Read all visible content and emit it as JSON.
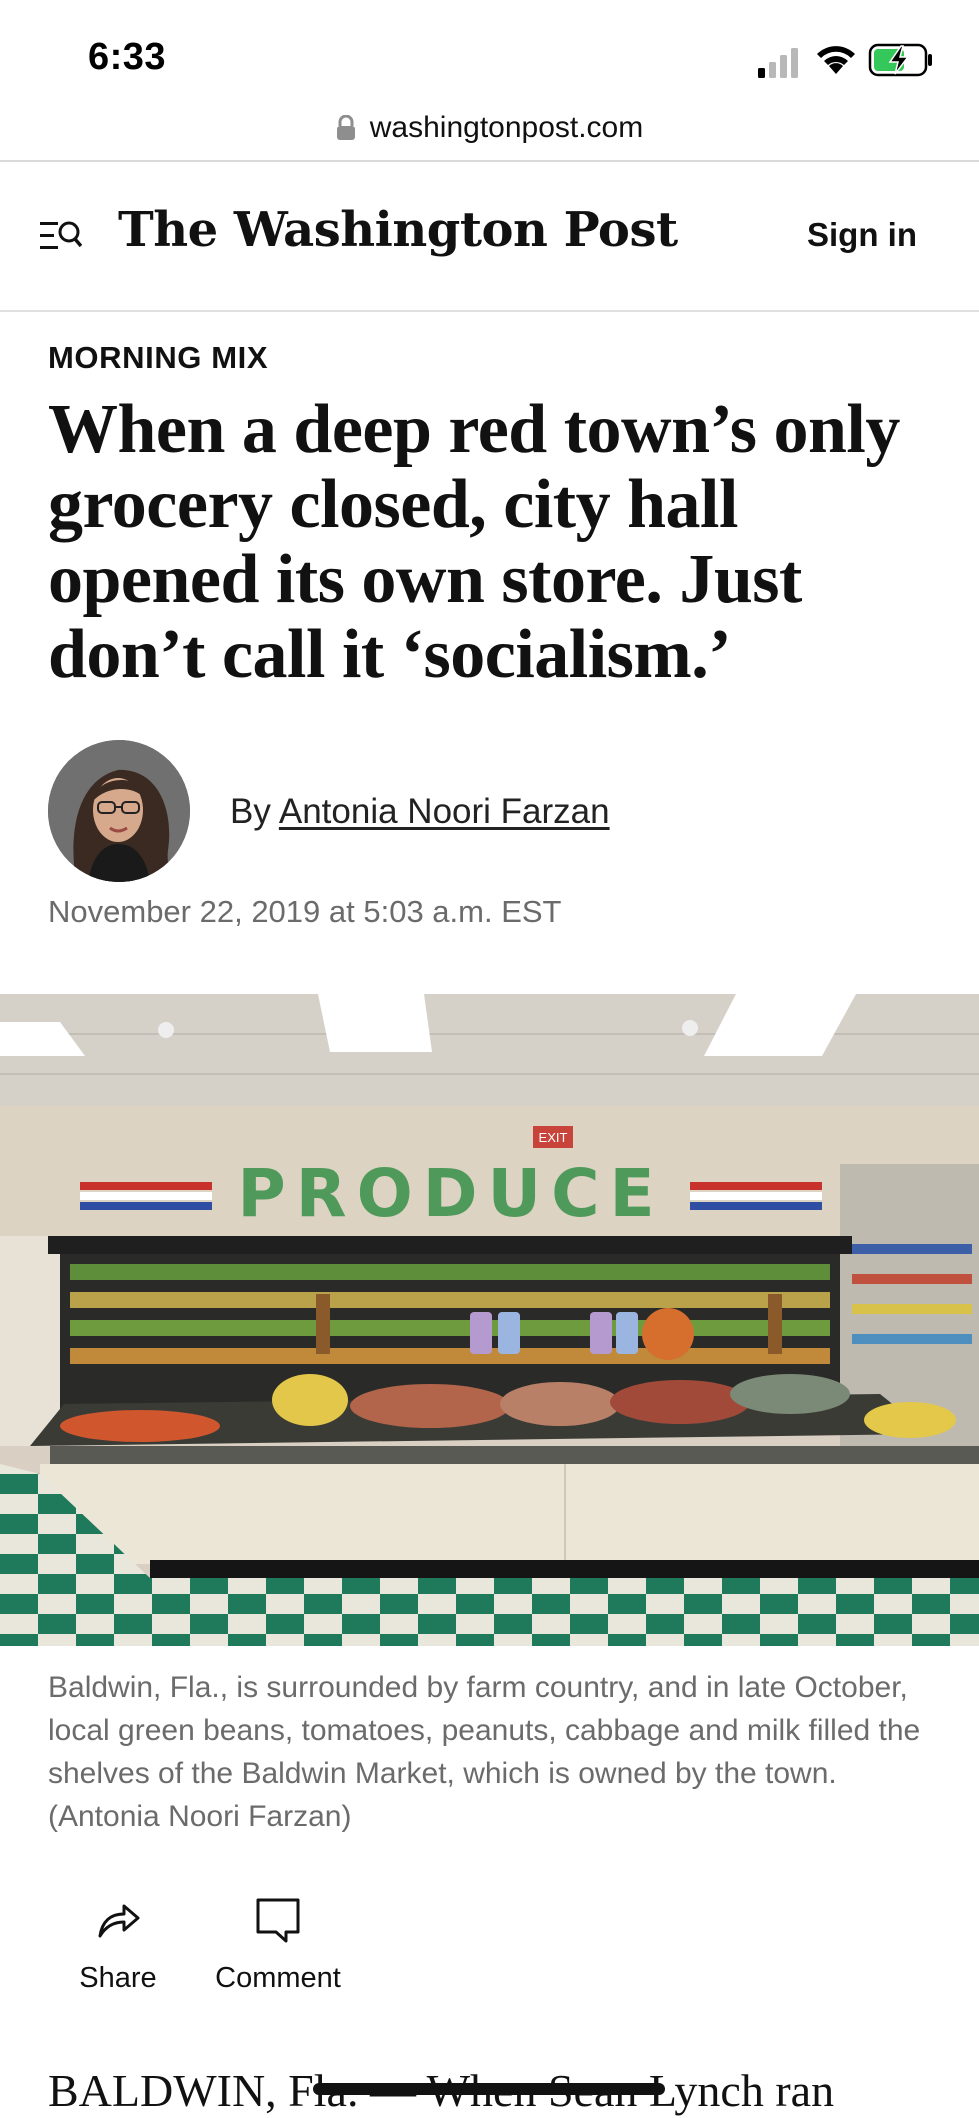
{
  "status_bar": {
    "time": "6:33"
  },
  "browser": {
    "url": "washingtonpost.com"
  },
  "header": {
    "masthead": "The Washington Post",
    "sign_in": "Sign in"
  },
  "article": {
    "kicker": "MORNING MIX",
    "headline": "When a deep red town’s only grocery closed, city hall opened its own store. Just don’t call it ‘socialism.’",
    "byline_prefix": "By",
    "author": "Antonia Noori Farzan",
    "date": "November 22, 2019 at 5:03 a.m. EST",
    "photo_sign_text": "PRODUCE",
    "photo_exit_text": "EXIT",
    "caption": "Baldwin, Fla., is surrounded by farm country, and in late October, local green beans, tomatoes, peanuts, cabbage and milk filled the shelves of the Baldwin Market, which is owned by the town. (Antonia Noori Farzan)",
    "body_start": "BALDWIN, Fla. — When Sean Lynch ran"
  },
  "actions": {
    "share": "Share",
    "comment": "Comment"
  },
  "colors": {
    "text": "#111111",
    "muted": "#6b6b6b",
    "divider": "#dadada",
    "produce_green": "#4f9a5a",
    "floor_green": "#1f7a5c",
    "battery_green": "#34c759"
  }
}
